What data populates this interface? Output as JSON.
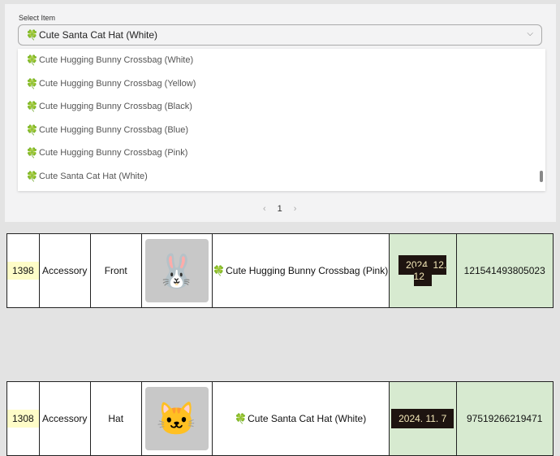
{
  "select": {
    "label": "Select Item",
    "value": "Cute Santa Cat Hat (White)",
    "options": [
      "Cute Hugging Bunny Crossbag (White)",
      "Cute Hugging Bunny Crossbag (Yellow)",
      "Cute Hugging Bunny Crossbag (Black)",
      "Cute Hugging Bunny Crossbag (Blue)",
      "Cute Hugging Bunny Crossbag (Pink)",
      "Cute Santa Cat Hat (White)"
    ]
  },
  "pagination": {
    "prev": "‹",
    "page": "1",
    "next": "›"
  },
  "rows": [
    {
      "id": "1398",
      "category": "Accessory",
      "slot": "Front",
      "name": "Cute Hugging Bunny Crossbag (Pink)",
      "date": "2024. 12. 12",
      "value": "121541493805023"
    },
    {
      "id": "1308",
      "category": "Accessory",
      "slot": "Hat",
      "name": "Cute Santa Cat Hat (White)",
      "date": "2024. 11. 7",
      "value": "97519266219471"
    }
  ]
}
